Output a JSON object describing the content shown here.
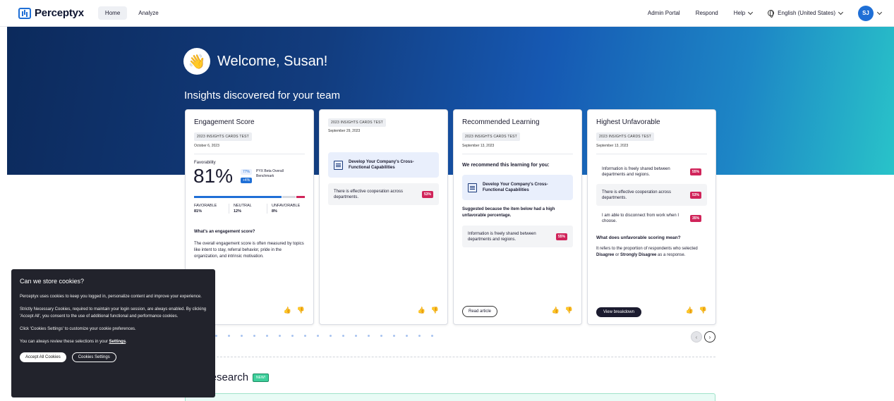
{
  "header": {
    "brand": "Perceptyx",
    "tabs": [
      {
        "label": "Home"
      },
      {
        "label": "Analyze"
      }
    ],
    "links": [
      "Admin Portal",
      "Respond",
      "Help",
      "English (United States)"
    ],
    "avatar_initials": "SJ"
  },
  "hero": {
    "welcome": "Welcome, Susan!",
    "insights_title": "Insights discovered for your team"
  },
  "cards": {
    "engagement": {
      "title": "Engagement Score",
      "tag": "2023 INSIGHTS CARDS TEST",
      "date": "October 6, 2023",
      "favorability_label": "Favorability",
      "score": "81%",
      "benchmark_value": "77%",
      "benchmark_delta": "+4%",
      "benchmark_label": "PYX Beta Overall Benchmark",
      "breakdown": [
        {
          "label": "FAVORABLE",
          "value": "81%"
        },
        {
          "label": "NEUTRAL",
          "value": "12%"
        },
        {
          "label": "UNFAVORABLE",
          "value": "8%"
        }
      ],
      "bar_fractions": {
        "favorable": 0.81,
        "neutral": 0.12,
        "unfavorable": 0.08
      },
      "question": "What's an engagement score?",
      "answer": "The overall engagement score is often measured by topics like intent to stay, referral behavior, pride in the organization, and intrinsic motivation."
    },
    "develop": {
      "tag": "2023 INSIGHTS CARDS TEST",
      "date": "September 29, 2023",
      "course": "Develop Your Company's Cross-Functional Capabilities",
      "statement": "There is effective cooperation across departments.",
      "statement_pct": "53%"
    },
    "learning": {
      "title": "Recommended Learning",
      "tag": "2023 INSIGHTS CARDS TEST",
      "date": "September 13, 2023",
      "recommend": "We recommend this learning for you:",
      "course": "Develop Your Company's Cross-Functional Capabilities",
      "reason": "Suggested because the item below had a high unfavorable percentage.",
      "statement": "Information is freely shared between departments and regions.",
      "statement_pct": "55%",
      "button": "Read article"
    },
    "unfavorable": {
      "title": "Highest Unfavorable",
      "tag": "2023 INSIGHTS CARDS TEST",
      "date": "September 13, 2023",
      "items": [
        {
          "text": "Information is freely shared between departments and regions.",
          "pct": "55%"
        },
        {
          "text": "There is effective cooperation across departments.",
          "pct": "53%"
        },
        {
          "text": "I am able to disconnect from work when I choose.",
          "pct": "35%"
        }
      ],
      "question": "What does unfavorable scoring mean?",
      "answer_prefix": "It refers to the proportion of respondents who selected ",
      "answer_bold1": "Disagree",
      "answer_mid": " or ",
      "answer_bold2": "Strongly Disagree",
      "answer_suffix": " as a response.",
      "button": "View breakdown"
    }
  },
  "research": {
    "title": "ptyx research",
    "badge": "NEW!"
  },
  "cookie": {
    "title": "Can we store cookies?",
    "p1": "Perceptyx uses cookies to keep you logged in, personalize content and improve your experience.",
    "p2": "Strictly Necessary Cookies, required to maintain your login session, are always enabled. By clicking 'Accept All', you consent to the use of additional functional and performance cookies.",
    "p3": "Click 'Cookies Settings' to customize your cookie preferences.",
    "p4_prefix": "You can always review these selections in your ",
    "p4_link": "Settings",
    "p4_suffix": ".",
    "accept": "Accept All Cookies",
    "settings": "Cookies Settings"
  },
  "colors": {
    "brand": "#1f6fd6",
    "unfavorable": "#d0245a",
    "favorable_bar": "#1f6fd6"
  },
  "icons": [
    "logo-icon",
    "chevron-down-icon",
    "globe-icon",
    "wave-hand-icon",
    "book-icon",
    "thumbs-up-icon",
    "thumbs-down-icon",
    "chevron-left-icon",
    "chevron-right-icon"
  ]
}
